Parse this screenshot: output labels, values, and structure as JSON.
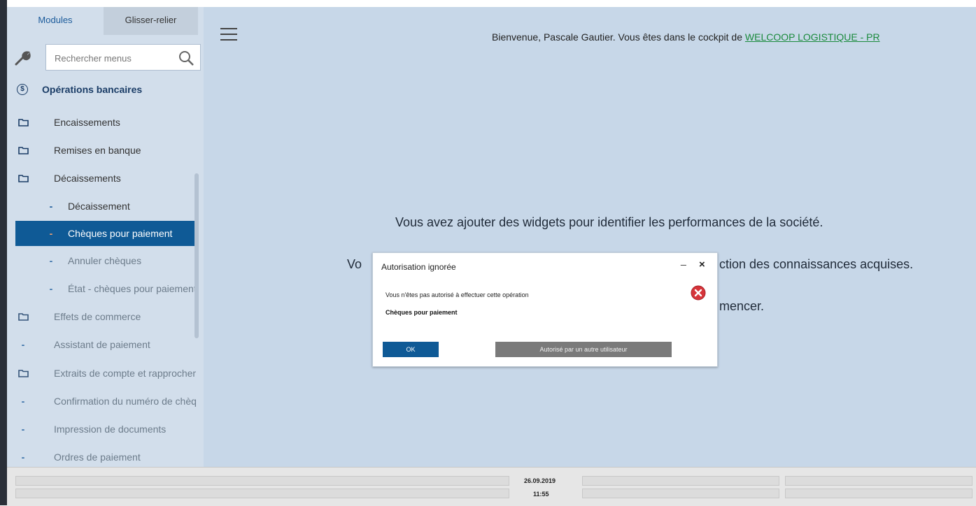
{
  "sidebar": {
    "tabs": [
      "Modules",
      "Glisser-relier"
    ],
    "search": {
      "placeholder": "Rechercher menus"
    },
    "header": "Opérations bancaires",
    "items": [
      {
        "label": "Encaissements",
        "type": "folder"
      },
      {
        "label": "Remises en banque",
        "type": "folder"
      },
      {
        "label": "Décaissements",
        "type": "folder"
      },
      {
        "label": "Décaissement",
        "type": "sub"
      },
      {
        "label": "Chèques pour paiement",
        "type": "sub",
        "selected": true
      },
      {
        "label": "Annuler chèques",
        "type": "sub"
      },
      {
        "label": "État - chèques pour paiement",
        "type": "sub"
      },
      {
        "label": "Effets de commerce",
        "type": "folder"
      },
      {
        "label": "Assistant de paiement",
        "type": "leaf"
      },
      {
        "label": "Extraits de compte et rapprochement",
        "type": "folder"
      },
      {
        "label": "Confirmation du numéro de chèque",
        "type": "leaf"
      },
      {
        "label": "Impression de documents",
        "type": "leaf"
      },
      {
        "label": "Ordres de paiement",
        "type": "leaf"
      }
    ]
  },
  "main": {
    "welcome_prefix": "Bienvenue, Pascale Gautier. Vous êtes dans le cockpit de ",
    "welcome_company": "WELCOOP LOGISTIQUE - PR",
    "message1": "Vous avez ajouter des widgets pour identifier les performances de la société.",
    "message2_left": "Vo",
    "message2_right": "ction des connaissances acquises.",
    "message3_right": "mencer."
  },
  "dialog": {
    "title": "Autorisation ignorée",
    "minimize": "_",
    "close": "×",
    "message": "Vous n'êtes pas autorisé à effectuer cette opération",
    "operation": "Chèques pour paiement",
    "ok_label": "OK",
    "other_user_label": "Autorisé par un autre utilisateur"
  },
  "statusbar": {
    "date": "26.09.2019",
    "time": "11:55"
  },
  "colors": {
    "accent": "#0f5a96",
    "sidebar_bg": "#d2deeb",
    "main_bg": "#c7d7e8",
    "error": "#d6343a",
    "link": "#1a8a3c"
  },
  "icons": [
    "wrench-icon",
    "search-icon",
    "dollar-icon",
    "folder-icon",
    "hamburger-icon",
    "error-icon",
    "close-icon"
  ]
}
